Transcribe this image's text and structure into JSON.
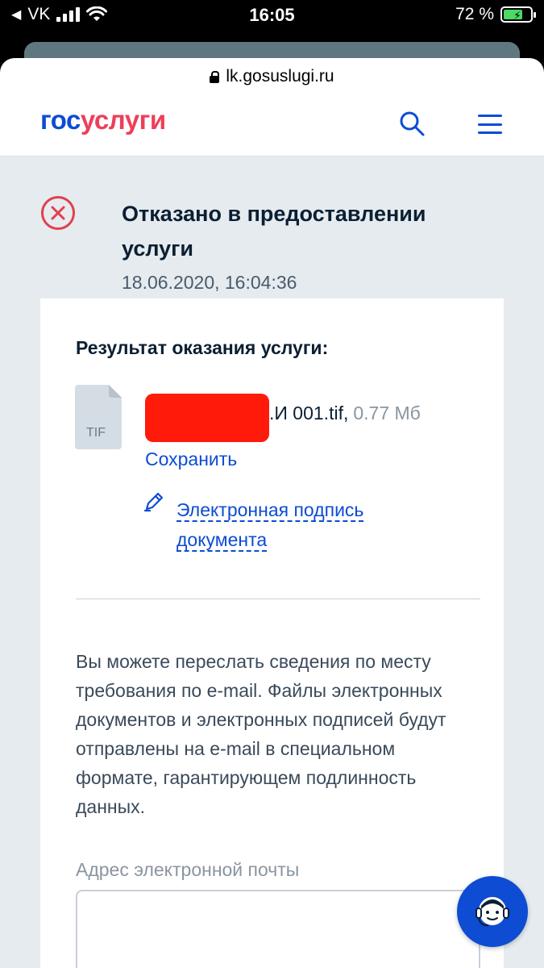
{
  "status_bar": {
    "carrier": "VK",
    "time": "16:05",
    "battery": "72 %"
  },
  "browser": {
    "url": "lk.gosuslugi.ru"
  },
  "header": {
    "logo_part1": "гос",
    "logo_part2": "услуги"
  },
  "status": {
    "title": "Отказано в предоставлении услуги",
    "date": "18.06.2020, 16:04:36"
  },
  "result": {
    "label": "Результат оказания услуги:",
    "file_icon_label": "TIF",
    "file_name_visible": ".И 001.tif,",
    "file_size": "0.77 Мб",
    "save_link": "Сохранить",
    "signature_link": "Электронная подпись документа"
  },
  "info_text": "Вы можете переслать сведения по месту требования по e-mail. Файлы электронных документов и электронных подписей будут отправлены на e-mail в специальном формате, гарантирующем подлинность данных.",
  "email": {
    "label": "Адрес электронной почты",
    "value": ""
  },
  "colors": {
    "brand_blue": "#0d4cd3",
    "brand_red": "#ee3f58",
    "error_red": "#e0404f"
  }
}
